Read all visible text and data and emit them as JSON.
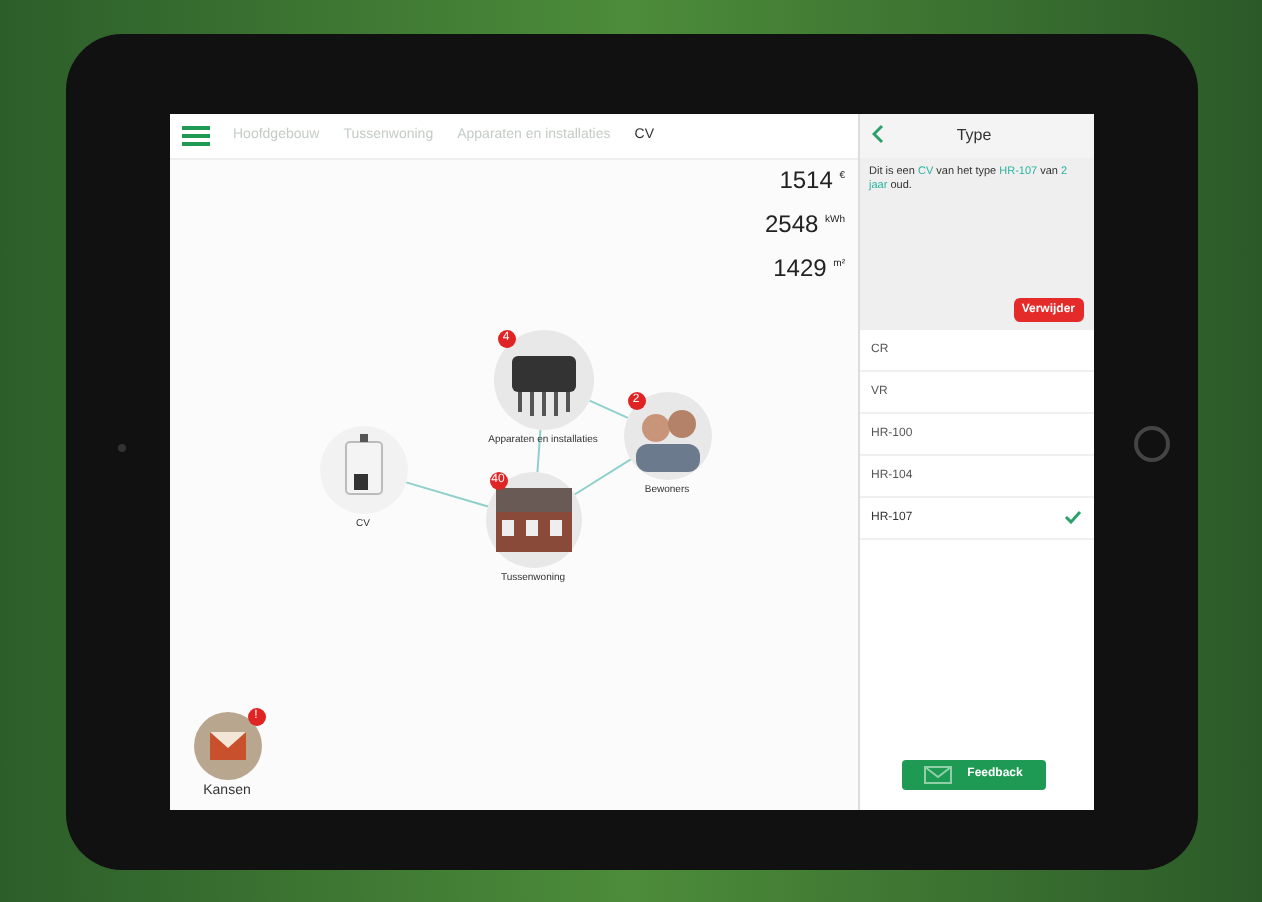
{
  "breadcrumb": [
    {
      "label": "Hoofdgebouw",
      "selected": false
    },
    {
      "label": "Tussenwoning",
      "selected": false
    },
    {
      "label": "Apparaten en installaties",
      "selected": false
    },
    {
      "label": "CV",
      "selected": true
    }
  ],
  "stats": [
    "1514 $^{€}$",
    "2548 $^{kWh}$",
    "1429 $^{m²}$"
  ],
  "nodes": [
    {
      "kind": "boiler",
      "label": "CV"
    },
    {
      "kind": "appliance",
      "label": "Apparaten en installaties",
      "badge": "4"
    },
    {
      "kind": "people",
      "label": "Bewoners",
      "badge": "2"
    },
    {
      "kind": "house",
      "label": "Tussenwoning",
      "badge": "40"
    }
  ],
  "panel": {
    "title": "Type",
    "description": "Dit is een **CV** van het type **HR-107** van **2 jaar** oud.",
    "delete_button": "Verwijder",
    "options": [
      {
        "label": "CR",
        "selected": false
      },
      {
        "label": "VR",
        "selected": false
      },
      {
        "label": "HR-100",
        "selected": false
      },
      {
        "label": "HR-104",
        "selected": false
      },
      {
        "label": "HR-107",
        "selected": true
      }
    ]
  },
  "opportunities": {
    "label": "Kansen",
    "badge": "!"
  },
  "feedback_button": "Feedback"
}
